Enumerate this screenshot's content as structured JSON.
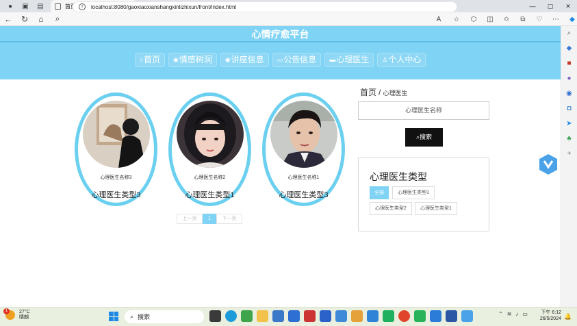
{
  "browser": {
    "tab_title": "首页",
    "url": "localhost:8080/gaoxiaoxianshangxinlizhixun/front/index.html",
    "window_controls": [
      "—",
      "▢",
      "✕"
    ]
  },
  "site": {
    "title": "心情疗愈平台",
    "nav": [
      {
        "label": "首页",
        "icon": "home-icon"
      },
      {
        "label": "情感树洞",
        "icon": "globe-icon"
      },
      {
        "label": "讲座信息",
        "icon": "globe-icon"
      },
      {
        "label": "公告信息",
        "icon": "book-icon"
      },
      {
        "label": "心理医生",
        "icon": "chat-icon"
      },
      {
        "label": "个人中心",
        "icon": "user-icon"
      }
    ]
  },
  "doctors": [
    {
      "name": "心理医生名称3",
      "type": "心理医生类型3"
    },
    {
      "name": "心理医生名称2",
      "type": "心理医生类型1"
    },
    {
      "name": "心理医生名称1",
      "type": "心理医生类型3"
    }
  ],
  "pagination": {
    "prev": "上一页",
    "current": "1",
    "next": "下一页"
  },
  "breadcrumb": {
    "home": "首页",
    "separator": "/",
    "current": "心理医生"
  },
  "search": {
    "placeholder": "心理医生名称",
    "button": "搜索"
  },
  "types_panel": {
    "title": "心理医生类型",
    "chips": [
      "全部",
      "心理医生类型3",
      "心理医生类型2",
      "心理医生类型1"
    ],
    "active": "全部"
  },
  "taskbar": {
    "weather_temp": "27°C",
    "weather_desc": "晴朗",
    "weather_badge": "1",
    "search_label": "搜索",
    "time": "下午 6:12",
    "date": "26/5/2024"
  },
  "colors": {
    "accent": "#7fd3f4",
    "card_border": "#6bd0f0",
    "button_dark": "#111111"
  }
}
